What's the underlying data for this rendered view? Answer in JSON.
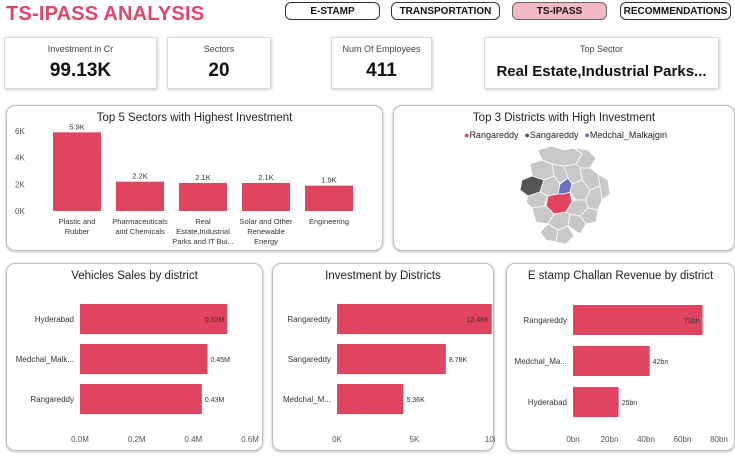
{
  "header": {
    "title": "TS-IPASS ANALYSIS"
  },
  "nav": [
    {
      "label": "E-STAMP",
      "active": false
    },
    {
      "label": "TRANSPORTATION",
      "active": false
    },
    {
      "label": "TS-IPASS",
      "active": true
    },
    {
      "label": "RECOMMENDATIONS",
      "active": false
    }
  ],
  "kpis": [
    {
      "label": "Investment in Cr",
      "value": "99.13K"
    },
    {
      "label": "Sectors",
      "value": "20"
    },
    {
      "label": "Num Of Employees",
      "value": "411"
    },
    {
      "label": "Top Sector",
      "value": "Real Estate,Industrial Parks..."
    }
  ],
  "colors": {
    "accent": "#e0456a",
    "bar": "#e0445f",
    "map_gray": "#c8c8c8",
    "sangareddy": "#555555",
    "medchal": "#6a6fc4"
  },
  "map_panel": {
    "title": "Top 3 Districts with High Investment",
    "legend": [
      {
        "name": "Rangareddy",
        "color": "#e0445f"
      },
      {
        "name": "Sangareddy",
        "color": "#555555"
      },
      {
        "name": "Medchal_Malkajgiri",
        "color": "#6a6fc4"
      }
    ]
  },
  "chart_data": [
    {
      "type": "bar",
      "title": "Top 5 Sectors with Highest Investment",
      "categories": [
        [
          "Plastic and",
          "Rubber"
        ],
        [
          "Pharmaceuticals",
          "and Chemicals"
        ],
        [
          "Real",
          "Estate,Industrial",
          "Parks and IT Bui..."
        ],
        [
          "Solar and Other",
          "Renewable",
          "Energy"
        ],
        [
          "Engineering"
        ]
      ],
      "values": [
        5.9,
        2.2,
        2.1,
        2.1,
        1.9
      ],
      "data_labels": [
        "5.9K",
        "2.2K",
        "2.1K",
        "2.1K",
        "1.9K"
      ],
      "yticks": [
        "0K",
        "2K",
        "4K",
        "6K"
      ],
      "ylim": [
        0,
        6
      ]
    },
    {
      "type": "bar",
      "orientation": "horizontal",
      "title": "Vehicles Sales by district",
      "categories": [
        "Hyderabad",
        "Medchal_Malk...",
        "Rangareddy"
      ],
      "values": [
        0.52,
        0.45,
        0.43
      ],
      "data_labels": [
        "0.52M",
        "0.45M",
        "0.43M"
      ],
      "xticks": [
        "0.0M",
        "0.2M",
        "0.4M",
        "0.6M"
      ],
      "xlim": [
        0,
        0.6
      ]
    },
    {
      "type": "bar",
      "orientation": "horizontal",
      "title": "Investment by Districts",
      "categories": [
        "Rangareddy",
        "Sangareddy",
        "Medchal_M..."
      ],
      "values": [
        12.48,
        8.78,
        5.36
      ],
      "data_labels": [
        "12.48K",
        "8.78K",
        "5.36K"
      ],
      "xticks": [
        "0K",
        "5K",
        "10K"
      ],
      "xlim": [
        0,
        12.5
      ]
    },
    {
      "type": "bar",
      "orientation": "horizontal",
      "title": "E stamp Challan Revenue by district",
      "categories": [
        "Rangareddy",
        "Medchal_Ma...",
        "Hyderabad"
      ],
      "values": [
        71,
        42,
        25
      ],
      "data_labels": [
        "71bn",
        "42bn",
        "25bn"
      ],
      "xticks": [
        "0bn",
        "20bn",
        "40bn",
        "60bn",
        "80bn"
      ],
      "xlim": [
        0,
        80
      ]
    }
  ]
}
